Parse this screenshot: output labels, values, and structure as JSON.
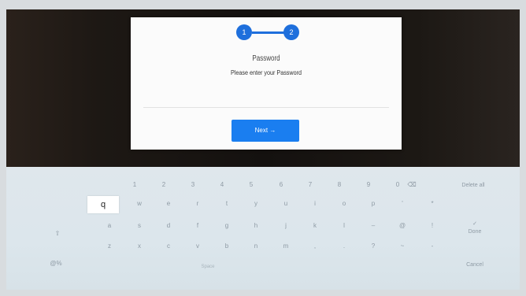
{
  "dialog": {
    "step1": "1",
    "step2": "2",
    "title": "Password",
    "subtitle": "Please enter your Password",
    "next_label": "Next →"
  },
  "keyboard": {
    "row1": [
      "1",
      "2",
      "3",
      "4",
      "5",
      "6",
      "7",
      "8",
      "9",
      "0"
    ],
    "row2": [
      "q",
      "w",
      "e",
      "r",
      "t",
      "y",
      "u",
      "i",
      "o",
      "p",
      "'",
      "*"
    ],
    "row3": [
      "a",
      "s",
      "d",
      "f",
      "g",
      "h",
      "j",
      "k",
      "l",
      "–",
      "@",
      "!"
    ],
    "row4": [
      "z",
      "x",
      "c",
      "v",
      "b",
      "n",
      "m",
      ",",
      ".",
      "?",
      "~",
      "-"
    ],
    "backspace": "⌫",
    "shift": "⇧",
    "symbols": "@%",
    "delete_all": "Delete all",
    "done": "Done",
    "cancel": "Cancel",
    "space": "Space",
    "done_check": "✓"
  },
  "colors": {
    "accent": "#1a7ef0",
    "step_dot": "#1e6fdc",
    "keyboard_bg": "#dfe7ec",
    "screen_bg": "#1d1814"
  }
}
